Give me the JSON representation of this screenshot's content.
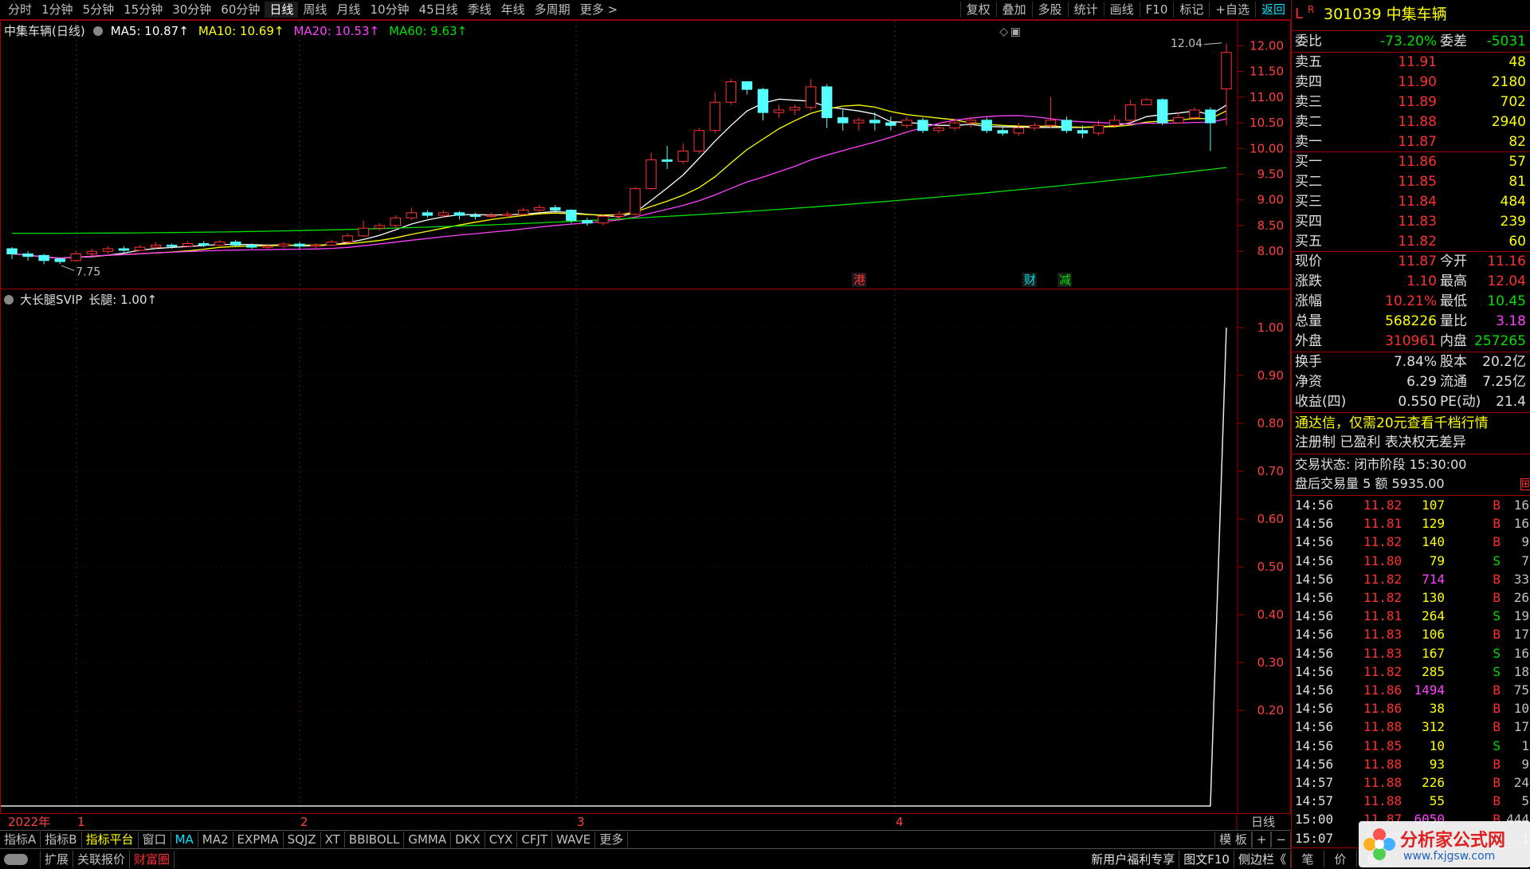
{
  "periods": [
    "分时",
    "1分钟",
    "5分钟",
    "15分钟",
    "30分钟",
    "60分钟",
    "日线",
    "周线",
    "月线",
    "10分钟",
    "45日线",
    "季线",
    "年线",
    "多周期",
    "更多 >"
  ],
  "active_period": "日线",
  "tools": [
    "复权",
    "叠加",
    "多股",
    "统计",
    "画线",
    "F10",
    "标记",
    "+自选",
    "返回"
  ],
  "main": {
    "title": "中集车辆(日线)",
    "ma": [
      {
        "label": "MA5: 10.87↑",
        "color": "#ffffff"
      },
      {
        "label": "MA10: 10.69↑",
        "color": "#ffff00"
      },
      {
        "label": "MA20: 10.53↑",
        "color": "#ff40ff"
      },
      {
        "label": "MA60: 9.63↑",
        "color": "#00e000"
      }
    ],
    "yticks": [
      "12.00",
      "11.50",
      "11.00",
      "10.50",
      "10.00",
      "9.50",
      "9.00",
      "8.50",
      "8.00"
    ],
    "high_label": "12.04",
    "low_label": "7.75",
    "markers": [
      {
        "text": "港",
        "color": "#ff3030"
      },
      {
        "text": "财",
        "color": "#00e0e0"
      },
      {
        "text": "减",
        "color": "#00e000"
      }
    ]
  },
  "indicator": {
    "title": "大长腿SVIP",
    "value_label": "长腿: 1.00↑",
    "yticks": [
      "1.00",
      "0.90",
      "0.80",
      "0.70",
      "0.60",
      "0.50",
      "0.40",
      "0.30",
      "0.20"
    ]
  },
  "xaxis": {
    "labels": [
      "2022年",
      "1",
      "2",
      "3",
      "4"
    ],
    "period_label": "日线"
  },
  "indicator_tabs": [
    "指标A",
    "指标B",
    "指标平台",
    "窗口",
    "MA",
    "MA2",
    "EXPMA",
    "SQJZ",
    "XT",
    "BBIBOLL",
    "GMMA",
    "DKX",
    "CYX",
    "CFJT",
    "WAVE",
    "更多"
  ],
  "indicator_tabs_right": [
    "模 板",
    "+",
    "−"
  ],
  "bottom_bar": {
    "expand": "扩展",
    "quote": "关联报价",
    "wealth": "财富圈",
    "promo": "新用户福利专享",
    "f10": "图文F10",
    "sidebar": "侧边栏《",
    "right_items": [
      "笔",
      "价",
      "细"
    ]
  },
  "stock": {
    "flag": "L",
    "badge": "R",
    "code_name": "301039 中集车辆",
    "weibi_label": "委比",
    "weibi": "-73.20%",
    "weicha_label": "委差",
    "weicha": "-5031",
    "asks": [
      {
        "label": "卖五",
        "price": "11.91",
        "vol": "48"
      },
      {
        "label": "卖四",
        "price": "11.90",
        "vol": "2180"
      },
      {
        "label": "卖三",
        "price": "11.89",
        "vol": "702"
      },
      {
        "label": "卖二",
        "price": "11.88",
        "vol": "2940"
      },
      {
        "label": "卖一",
        "price": "11.87",
        "vol": "82"
      }
    ],
    "bids": [
      {
        "label": "买一",
        "price": "11.86",
        "vol": "57"
      },
      {
        "label": "买二",
        "price": "11.85",
        "vol": "81"
      },
      {
        "label": "买三",
        "price": "11.84",
        "vol": "484"
      },
      {
        "label": "买四",
        "price": "11.83",
        "vol": "239"
      },
      {
        "label": "买五",
        "price": "11.82",
        "vol": "60"
      }
    ],
    "quote": [
      {
        "l1": "现价",
        "v1": "11.87",
        "c1": "#ff3030",
        "l2": "今开",
        "v2": "11.16",
        "c2": "#ff3030"
      },
      {
        "l1": "涨跌",
        "v1": "1.10",
        "c1": "#ff3030",
        "l2": "最高",
        "v2": "12.04",
        "c2": "#ff3030"
      },
      {
        "l1": "涨幅",
        "v1": "10.21%",
        "c1": "#ff3030",
        "l2": "最低",
        "v2": "10.45",
        "c2": "#00e000"
      },
      {
        "l1": "总量",
        "v1": "568226",
        "c1": "#ffff00",
        "l2": "量比",
        "v2": "3.18",
        "c2": "#ff40ff"
      },
      {
        "l1": "外盘",
        "v1": "310961",
        "c1": "#ff3030",
        "l2": "内盘",
        "v2": "257265",
        "c2": "#00e000"
      }
    ],
    "fundamentals": [
      {
        "l1": "换手",
        "v1": "7.84%",
        "l2": "股本",
        "v2": "20.2亿"
      },
      {
        "l1": "净资",
        "v1": "6.29",
        "l2": "流通",
        "v2": "7.25亿"
      },
      {
        "l1": "收益(四)",
        "v1": "0.550",
        "l2": "PE(动)",
        "v2": "21.4"
      }
    ],
    "ad": "通达信，仅需20元查看千档行情",
    "reg": "注册制 已盈利 表决权无差异",
    "trade_status": "交易状态: 闭市阶段 15:30:00",
    "after_hours": "盘后交易量 5 额 5935.00",
    "ticks": [
      {
        "t": "14:56",
        "p": "11.82",
        "v": "107",
        "s": "B",
        "n": "16"
      },
      {
        "t": "14:56",
        "p": "11.81",
        "v": "129",
        "s": "B",
        "n": "16"
      },
      {
        "t": "14:56",
        "p": "11.82",
        "v": "140",
        "s": "B",
        "n": "9"
      },
      {
        "t": "14:56",
        "p": "11.80",
        "v": "79",
        "s": "S",
        "n": "7"
      },
      {
        "t": "14:56",
        "p": "11.82",
        "v": "714",
        "s": "B",
        "n": "33"
      },
      {
        "t": "14:56",
        "p": "11.82",
        "v": "130",
        "s": "B",
        "n": "26"
      },
      {
        "t": "14:56",
        "p": "11.81",
        "v": "264",
        "s": "S",
        "n": "19"
      },
      {
        "t": "14:56",
        "p": "11.83",
        "v": "106",
        "s": "B",
        "n": "17"
      },
      {
        "t": "14:56",
        "p": "11.83",
        "v": "167",
        "s": "S",
        "n": "16"
      },
      {
        "t": "14:56",
        "p": "11.82",
        "v": "285",
        "s": "S",
        "n": "18"
      },
      {
        "t": "14:56",
        "p": "11.86",
        "v": "1494",
        "s": "B",
        "n": "75"
      },
      {
        "t": "14:56",
        "p": "11.86",
        "v": "38",
        "s": "B",
        "n": "10"
      },
      {
        "t": "14:56",
        "p": "11.88",
        "v": "312",
        "s": "B",
        "n": "17"
      },
      {
        "t": "14:56",
        "p": "11.85",
        "v": "10",
        "s": "S",
        "n": "1"
      },
      {
        "t": "14:56",
        "p": "11.88",
        "v": "93",
        "s": "B",
        "n": "9"
      },
      {
        "t": "14:57",
        "p": "11.88",
        "v": "226",
        "s": "B",
        "n": "24"
      },
      {
        "t": "14:57",
        "p": "11.88",
        "v": "55",
        "s": "B",
        "n": "5"
      },
      {
        "t": "15:00",
        "p": "11.87",
        "v": "6050",
        "s": "B",
        "n": "444"
      },
      {
        "t": "15:07",
        "p": "11.87",
        "v": "5",
        "s": "B",
        "n": "1"
      }
    ]
  },
  "watermark": {
    "cn": "分析家公式网",
    "url": "www.fxjgsw.com"
  },
  "chart_data": [
    {
      "type": "candlestick",
      "title": "中集车辆(日线)",
      "ylim": [
        7.6,
        12.3
      ],
      "candles": [
        [
          8.05,
          7.95,
          8.08,
          7.85
        ],
        [
          7.95,
          7.9,
          8.0,
          7.82
        ],
        [
          7.92,
          7.82,
          7.95,
          7.75
        ],
        [
          7.85,
          7.8,
          7.88,
          7.75
        ],
        [
          7.82,
          7.95,
          8.0,
          7.8
        ],
        [
          7.95,
          8.0,
          8.05,
          7.9
        ],
        [
          8.0,
          8.05,
          8.1,
          7.95
        ],
        [
          8.05,
          8.02,
          8.1,
          7.98
        ],
        [
          8.02,
          8.08,
          8.12,
          8.0
        ],
        [
          8.08,
          8.12,
          8.18,
          8.05
        ],
        [
          8.12,
          8.1,
          8.15,
          8.05
        ],
        [
          8.1,
          8.15,
          8.2,
          8.08
        ],
        [
          8.15,
          8.12,
          8.2,
          8.08
        ],
        [
          8.12,
          8.18,
          8.22,
          8.1
        ],
        [
          8.18,
          8.12,
          8.22,
          8.1
        ],
        [
          8.12,
          8.08,
          8.15,
          8.05
        ],
        [
          8.08,
          8.1,
          8.15,
          8.05
        ],
        [
          8.1,
          8.14,
          8.18,
          8.06
        ],
        [
          8.14,
          8.1,
          8.18,
          8.05
        ],
        [
          8.1,
          8.12,
          8.16,
          8.06
        ],
        [
          8.12,
          8.18,
          8.22,
          8.1
        ],
        [
          8.18,
          8.3,
          8.35,
          8.15
        ],
        [
          8.3,
          8.45,
          8.6,
          8.28
        ],
        [
          8.45,
          8.5,
          8.55,
          8.4
        ],
        [
          8.5,
          8.65,
          8.7,
          8.45
        ],
        [
          8.65,
          8.75,
          8.85,
          8.6
        ],
        [
          8.75,
          8.7,
          8.8,
          8.65
        ],
        [
          8.7,
          8.75,
          8.8,
          8.65
        ],
        [
          8.75,
          8.7,
          8.78,
          8.62
        ],
        [
          8.7,
          8.68,
          8.75,
          8.62
        ],
        [
          8.68,
          8.7,
          8.75,
          8.65
        ],
        [
          8.7,
          8.72,
          8.78,
          8.65
        ],
        [
          8.72,
          8.8,
          8.85,
          8.7
        ],
        [
          8.8,
          8.85,
          8.9,
          8.75
        ],
        [
          8.85,
          8.8,
          8.9,
          8.75
        ],
        [
          8.8,
          8.6,
          8.82,
          8.55
        ],
        [
          8.6,
          8.55,
          8.65,
          8.5
        ],
        [
          8.55,
          8.68,
          8.72,
          8.5
        ],
        [
          8.68,
          8.72,
          8.78,
          8.62
        ],
        [
          8.72,
          9.22,
          9.25,
          8.7
        ],
        [
          9.22,
          9.78,
          9.92,
          9.2
        ],
        [
          9.78,
          9.75,
          10.05,
          9.6
        ],
        [
          9.75,
          9.95,
          10.1,
          9.7
        ],
        [
          9.95,
          10.35,
          10.4,
          9.9
        ],
        [
          10.35,
          10.9,
          11.1,
          10.3
        ],
        [
          10.9,
          11.3,
          11.35,
          10.85
        ],
        [
          11.3,
          11.15,
          11.25,
          11.05
        ],
        [
          11.15,
          10.7,
          11.18,
          10.55
        ],
        [
          10.7,
          10.75,
          10.85,
          10.6
        ],
        [
          10.75,
          10.8,
          10.85,
          10.65
        ],
        [
          10.8,
          11.2,
          11.35,
          10.75
        ],
        [
          11.2,
          10.6,
          11.25,
          10.4
        ],
        [
          10.6,
          10.5,
          10.75,
          10.35
        ],
        [
          10.5,
          10.55,
          10.6,
          10.35
        ],
        [
          10.55,
          10.5,
          10.7,
          10.35
        ],
        [
          10.5,
          10.45,
          10.62,
          10.35
        ],
        [
          10.45,
          10.55,
          10.62,
          10.4
        ],
        [
          10.55,
          10.35,
          10.6,
          10.3
        ],
        [
          10.35,
          10.4,
          10.5,
          10.3
        ],
        [
          10.4,
          10.5,
          10.55,
          10.35
        ],
        [
          10.5,
          10.55,
          10.62,
          10.4
        ],
        [
          10.55,
          10.35,
          10.6,
          10.3
        ],
        [
          10.35,
          10.3,
          10.45,
          10.25
        ],
        [
          10.3,
          10.4,
          10.5,
          10.25
        ],
        [
          10.4,
          10.45,
          10.5,
          10.35
        ],
        [
          10.45,
          10.55,
          11.0,
          10.4
        ],
        [
          10.55,
          10.35,
          10.62,
          10.3
        ],
        [
          10.35,
          10.3,
          10.45,
          10.2
        ],
        [
          10.3,
          10.45,
          10.55,
          10.25
        ],
        [
          10.45,
          10.55,
          10.65,
          10.4
        ],
        [
          10.55,
          10.85,
          10.95,
          10.5
        ],
        [
          10.85,
          10.95,
          10.98,
          10.85
        ],
        [
          10.95,
          10.5,
          10.98,
          10.45
        ],
        [
          10.5,
          10.6,
          10.7,
          10.48
        ],
        [
          10.6,
          10.75,
          10.8,
          10.55
        ],
        [
          10.75,
          10.5,
          10.8,
          9.95
        ],
        [
          11.16,
          11.87,
          12.04,
          10.45
        ]
      ],
      "ma": {
        "MA5": {
          "color": "#ffffff",
          "values": []
        },
        "MA10": {
          "color": "#ffff00",
          "values": []
        },
        "MA20": {
          "color": "#ff40ff",
          "values": []
        },
        "MA60": {
          "color": "#00e000",
          "values": []
        }
      },
      "ma_last": {
        "MA5": 10.87,
        "MA10": 10.69,
        "MA20": 10.53,
        "MA60": 9.63
      }
    },
    {
      "type": "line",
      "title": "大长腿SVIP",
      "series": [
        {
          "name": "长腿",
          "values_note": "flat near 0 then jumps to 1.00 on last bar"
        }
      ],
      "ylim": [
        0,
        1.05
      ],
      "last_value": 1.0
    }
  ]
}
